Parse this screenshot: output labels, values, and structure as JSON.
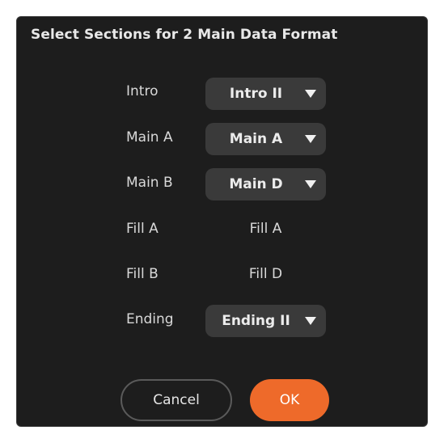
{
  "dialog": {
    "title": "Select Sections for 2 Main Data Format"
  },
  "rows": [
    {
      "label": "Intro",
      "value": "Intro II",
      "type": "dropdown"
    },
    {
      "label": "Main A",
      "value": "Main A",
      "type": "dropdown"
    },
    {
      "label": "Main B",
      "value": "Main D",
      "type": "dropdown"
    },
    {
      "label": "Fill A",
      "value": "Fill A",
      "type": "static"
    },
    {
      "label": "Fill B",
      "value": "Fill D",
      "type": "static"
    },
    {
      "label": "Ending",
      "value": "Ending II",
      "type": "dropdown"
    }
  ],
  "buttons": {
    "cancel_label": "Cancel",
    "ok_label": "OK"
  },
  "colors": {
    "background": "#1d1d1d",
    "dropdown_bg": "#3a3a3a",
    "accent": "#ee6a2a",
    "text": "#d9d9d9"
  },
  "icons": {
    "dropdown_arrow": "triangle-down-icon"
  }
}
